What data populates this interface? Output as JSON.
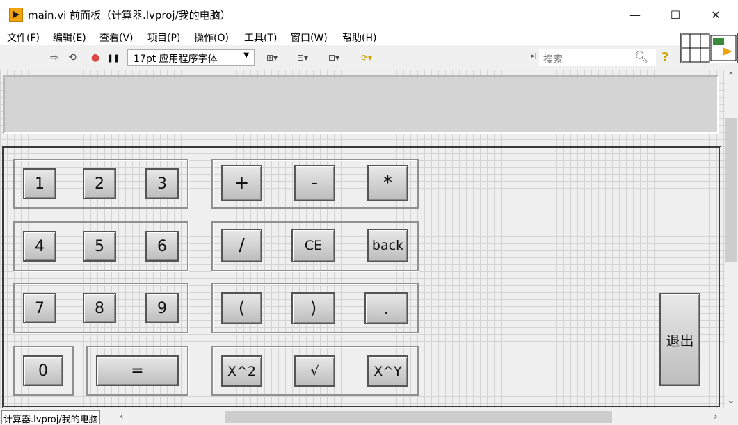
{
  "window": {
    "title": "main.vi 前面板（计算器.lvproj/我的电脑）",
    "minimize": "—",
    "maximize": "☐",
    "close": "✕"
  },
  "menu": [
    "文件(F)",
    "编辑(E)",
    "查看(V)",
    "项目(P)",
    "操作(O)",
    "工具(T)",
    "窗口(W)",
    "帮助(H)"
  ],
  "toolbar": {
    "run": "⇨",
    "run_continuous": "⟲",
    "abort": "●",
    "pause": "❚❚",
    "font": "17pt 应用程序字体",
    "align": "⊞▾",
    "distribute": "⊟▾",
    "resize": "⊡▾",
    "reorder": "⟳▾",
    "search_placeholder": "搜索"
  },
  "calculator": {
    "display_value": "",
    "digits": [
      "1",
      "2",
      "3",
      "4",
      "5",
      "6",
      "7",
      "8",
      "9",
      "0"
    ],
    "equals": "=",
    "ops": [
      "+",
      "-",
      "*",
      "/",
      "CE",
      "back",
      "(",
      ")",
      ".",
      "X^2",
      "√",
      "X^Y"
    ],
    "exit": "退出"
  },
  "status": {
    "project_path": "计算器.lvproj/我的电脑"
  },
  "colors": {
    "app_icon": "#f0a30a",
    "grid": "#d4d4d4",
    "button_face": "#d0d0d0"
  }
}
